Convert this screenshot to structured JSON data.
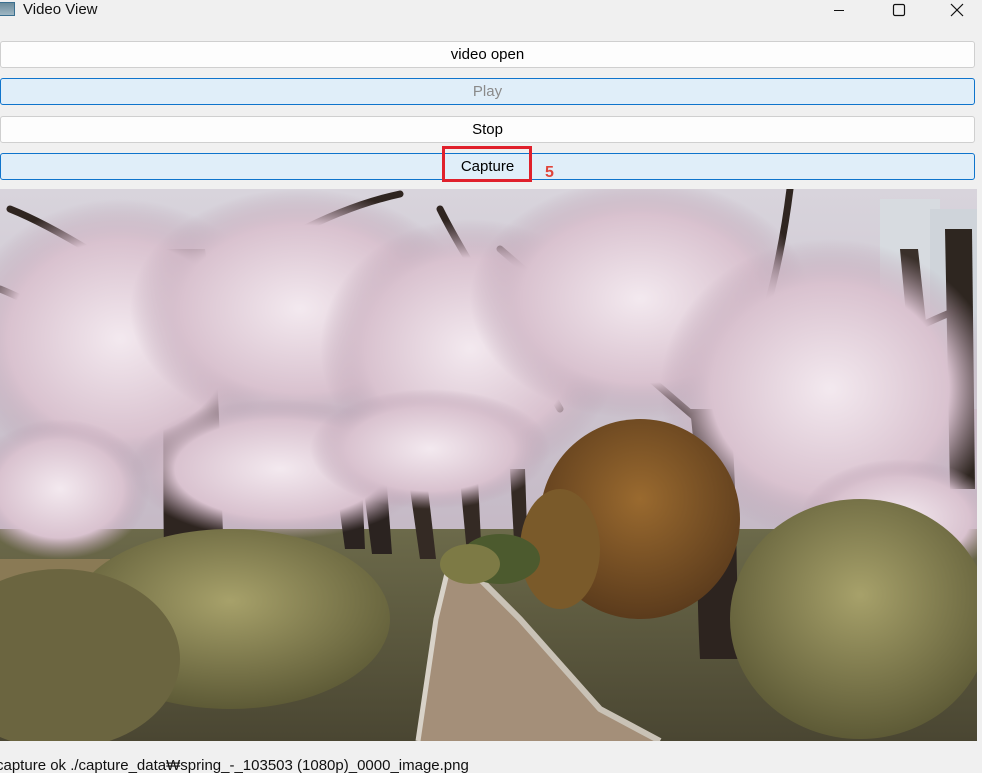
{
  "window": {
    "title": "Video View"
  },
  "buttons": {
    "open_label": "video open",
    "play_label": "Play",
    "stop_label": "Stop",
    "capture_label": "Capture"
  },
  "annotation": {
    "step_number": "5",
    "highlight_color": "#e0202b"
  },
  "video": {
    "scene": "cherry blossom path"
  },
  "status": {
    "text": "capture ok ./capture_data₩spring_-_103503 (1080p)_0000_image.png"
  },
  "colors": {
    "focus_border": "#0f74cc",
    "focus_bg": "#e0eef9",
    "button_bg": "#fdfdfd",
    "window_bg": "#f0f0f0"
  }
}
